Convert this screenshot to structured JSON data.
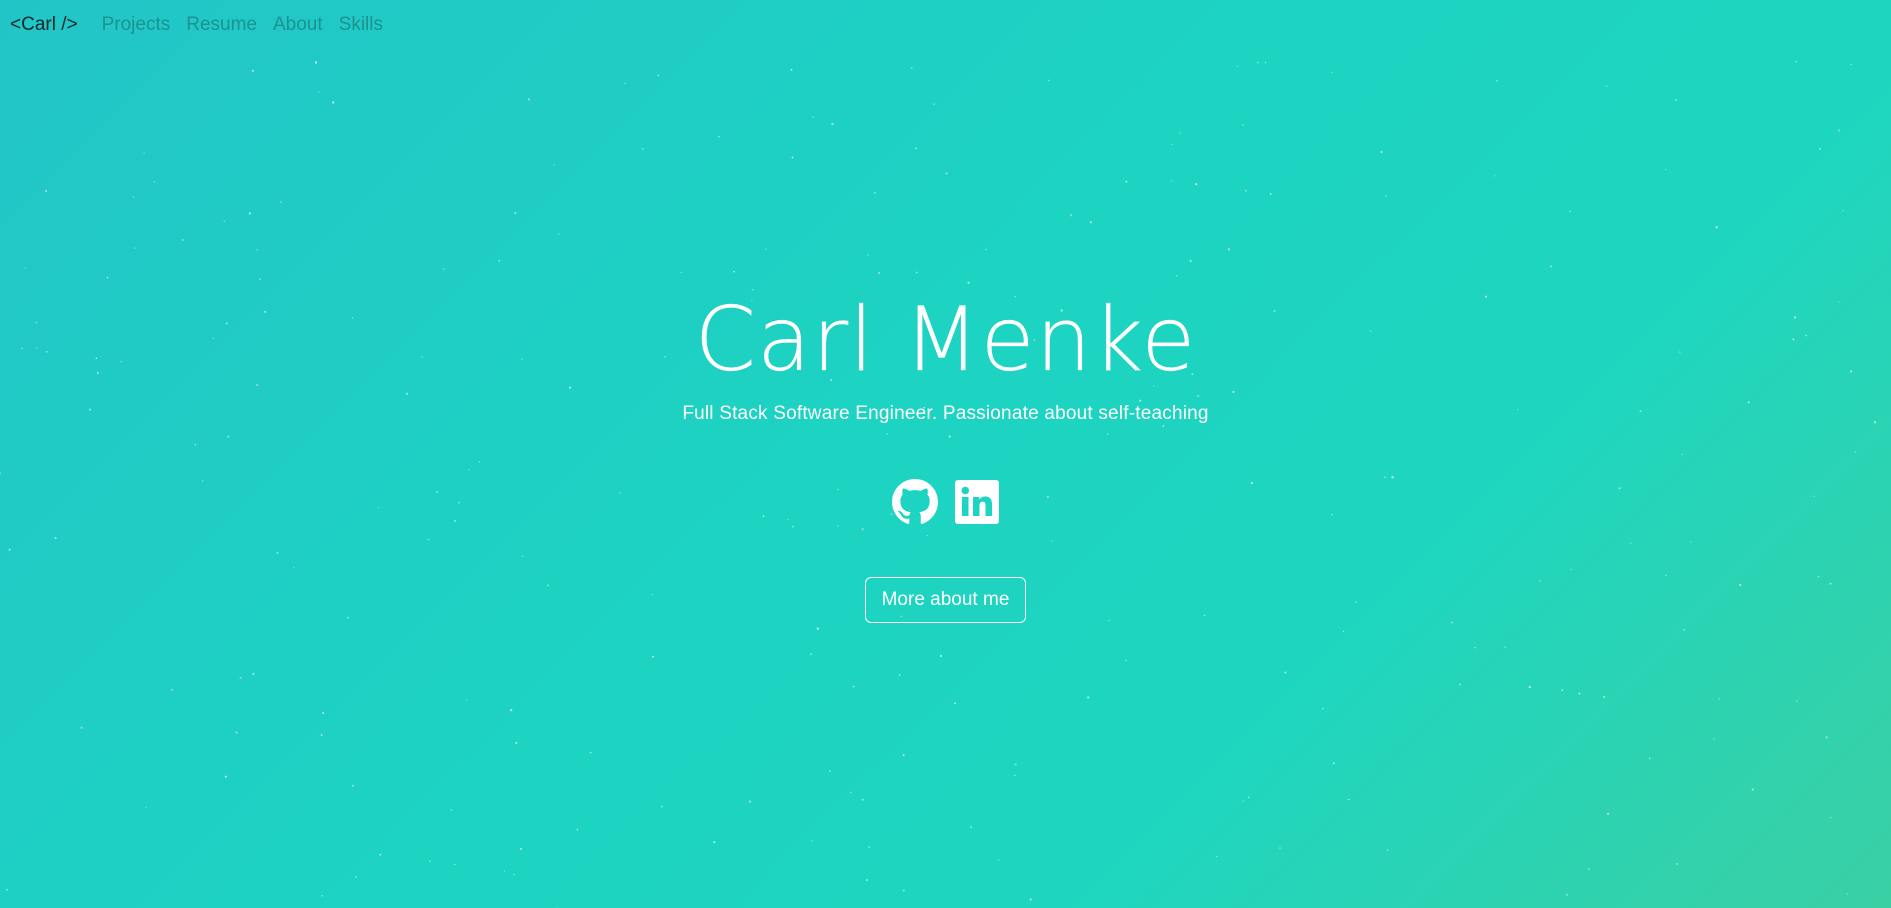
{
  "nav": {
    "brand": "<Carl />",
    "links": [
      {
        "label": "Projects"
      },
      {
        "label": "Resume"
      },
      {
        "label": "About"
      },
      {
        "label": "Skills"
      }
    ]
  },
  "hero": {
    "title": "Carl Menke",
    "subtitle": "Full Stack Software Engineer. Passionate about self-teaching",
    "socials": [
      {
        "icon": "github-icon"
      },
      {
        "icon": "linkedin-icon"
      }
    ],
    "cta_label": "More about me"
  },
  "colors": {
    "background_start": "#22c5c7",
    "background_mid": "#1dd3c2",
    "background_end": "#3ad0a4",
    "text": "#ffffff",
    "nav_link": "#1a8a86",
    "brand": "#0f2a2a"
  }
}
